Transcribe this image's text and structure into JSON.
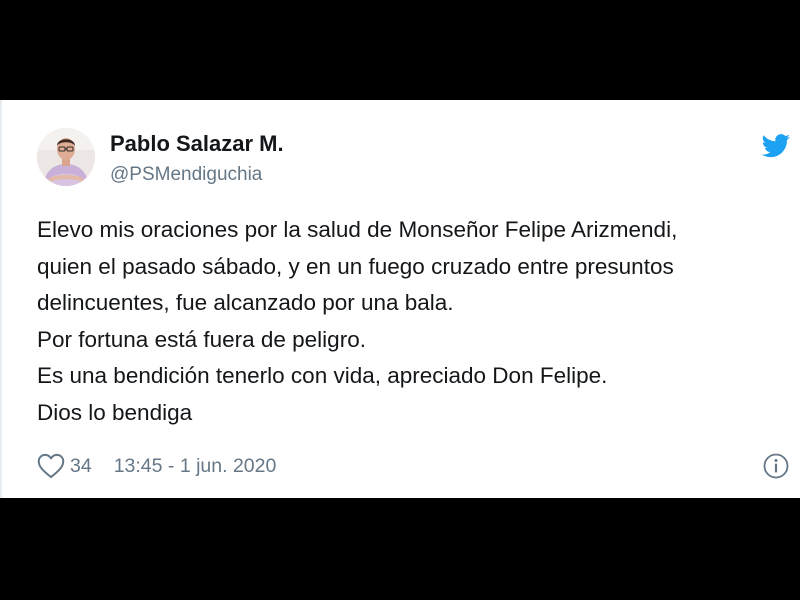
{
  "user": {
    "display_name": "Pablo Salazar M.",
    "handle": "@PSMendiguchia",
    "avatar_icon": "profile-photo"
  },
  "tweet": {
    "lines": [
      "Elevo mis oraciones por la salud de Monseñor Felipe Arizmendi,",
      "quien el pasado sábado, y en un fuego cruzado entre presuntos",
      "delincuentes, fue alcanzado por una bala.",
      "Por fortuna está fuera de peligro.",
      "Es una bendición tenerlo con vida, apreciado Don Felipe.",
      "Dios lo bendiga"
    ]
  },
  "footer": {
    "like_count": "34",
    "timestamp": "13:45 - 1 jun. 2020"
  },
  "icons": {
    "brand": "twitter-bird-icon",
    "like": "heart-icon",
    "info": "info-icon"
  },
  "colors": {
    "brand": "#1da1f2",
    "text": "#14171a",
    "secondary": "#657786",
    "frame": "#000000",
    "card": "#ffffff"
  }
}
